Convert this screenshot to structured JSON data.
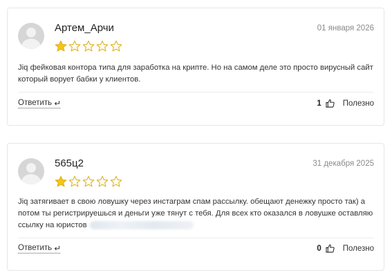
{
  "reviews": [
    {
      "author": "Артем_Арчи",
      "date": "01 января 2026",
      "rating": 1,
      "max_rating": 5,
      "text": "Jiq фейковая контора типа для заработка на крипте. Но на самом деле это просто вирусный сайт который ворует бабки у клиентов.",
      "reply_label": "Ответить",
      "helpful_count": "1",
      "helpful_label": "Полезно"
    },
    {
      "author": "565ц2",
      "date": "31 декабря 2025",
      "rating": 1,
      "max_rating": 5,
      "text": "Jiq затягивает в свою ловушку через инстаграм спам рассылку. обещают денежку просто так) а потом ты регистрируешься и деньги уже тянут с тебя. Для всех кто оказался в ловушке оставляю ссылку на юристов",
      "reply_label": "Ответить",
      "helpful_count": "0",
      "helpful_label": "Полезно"
    }
  ],
  "colors": {
    "star_fill": "#f5c518",
    "star_outline": "#e0b21a",
    "border": "#e6e6e6",
    "date": "#8a8a8a"
  },
  "icons": {
    "avatar": "default-user-avatar",
    "reply": "reply-arrow-icon",
    "helpful": "thumbs-up-icon",
    "star": "star-icon"
  }
}
